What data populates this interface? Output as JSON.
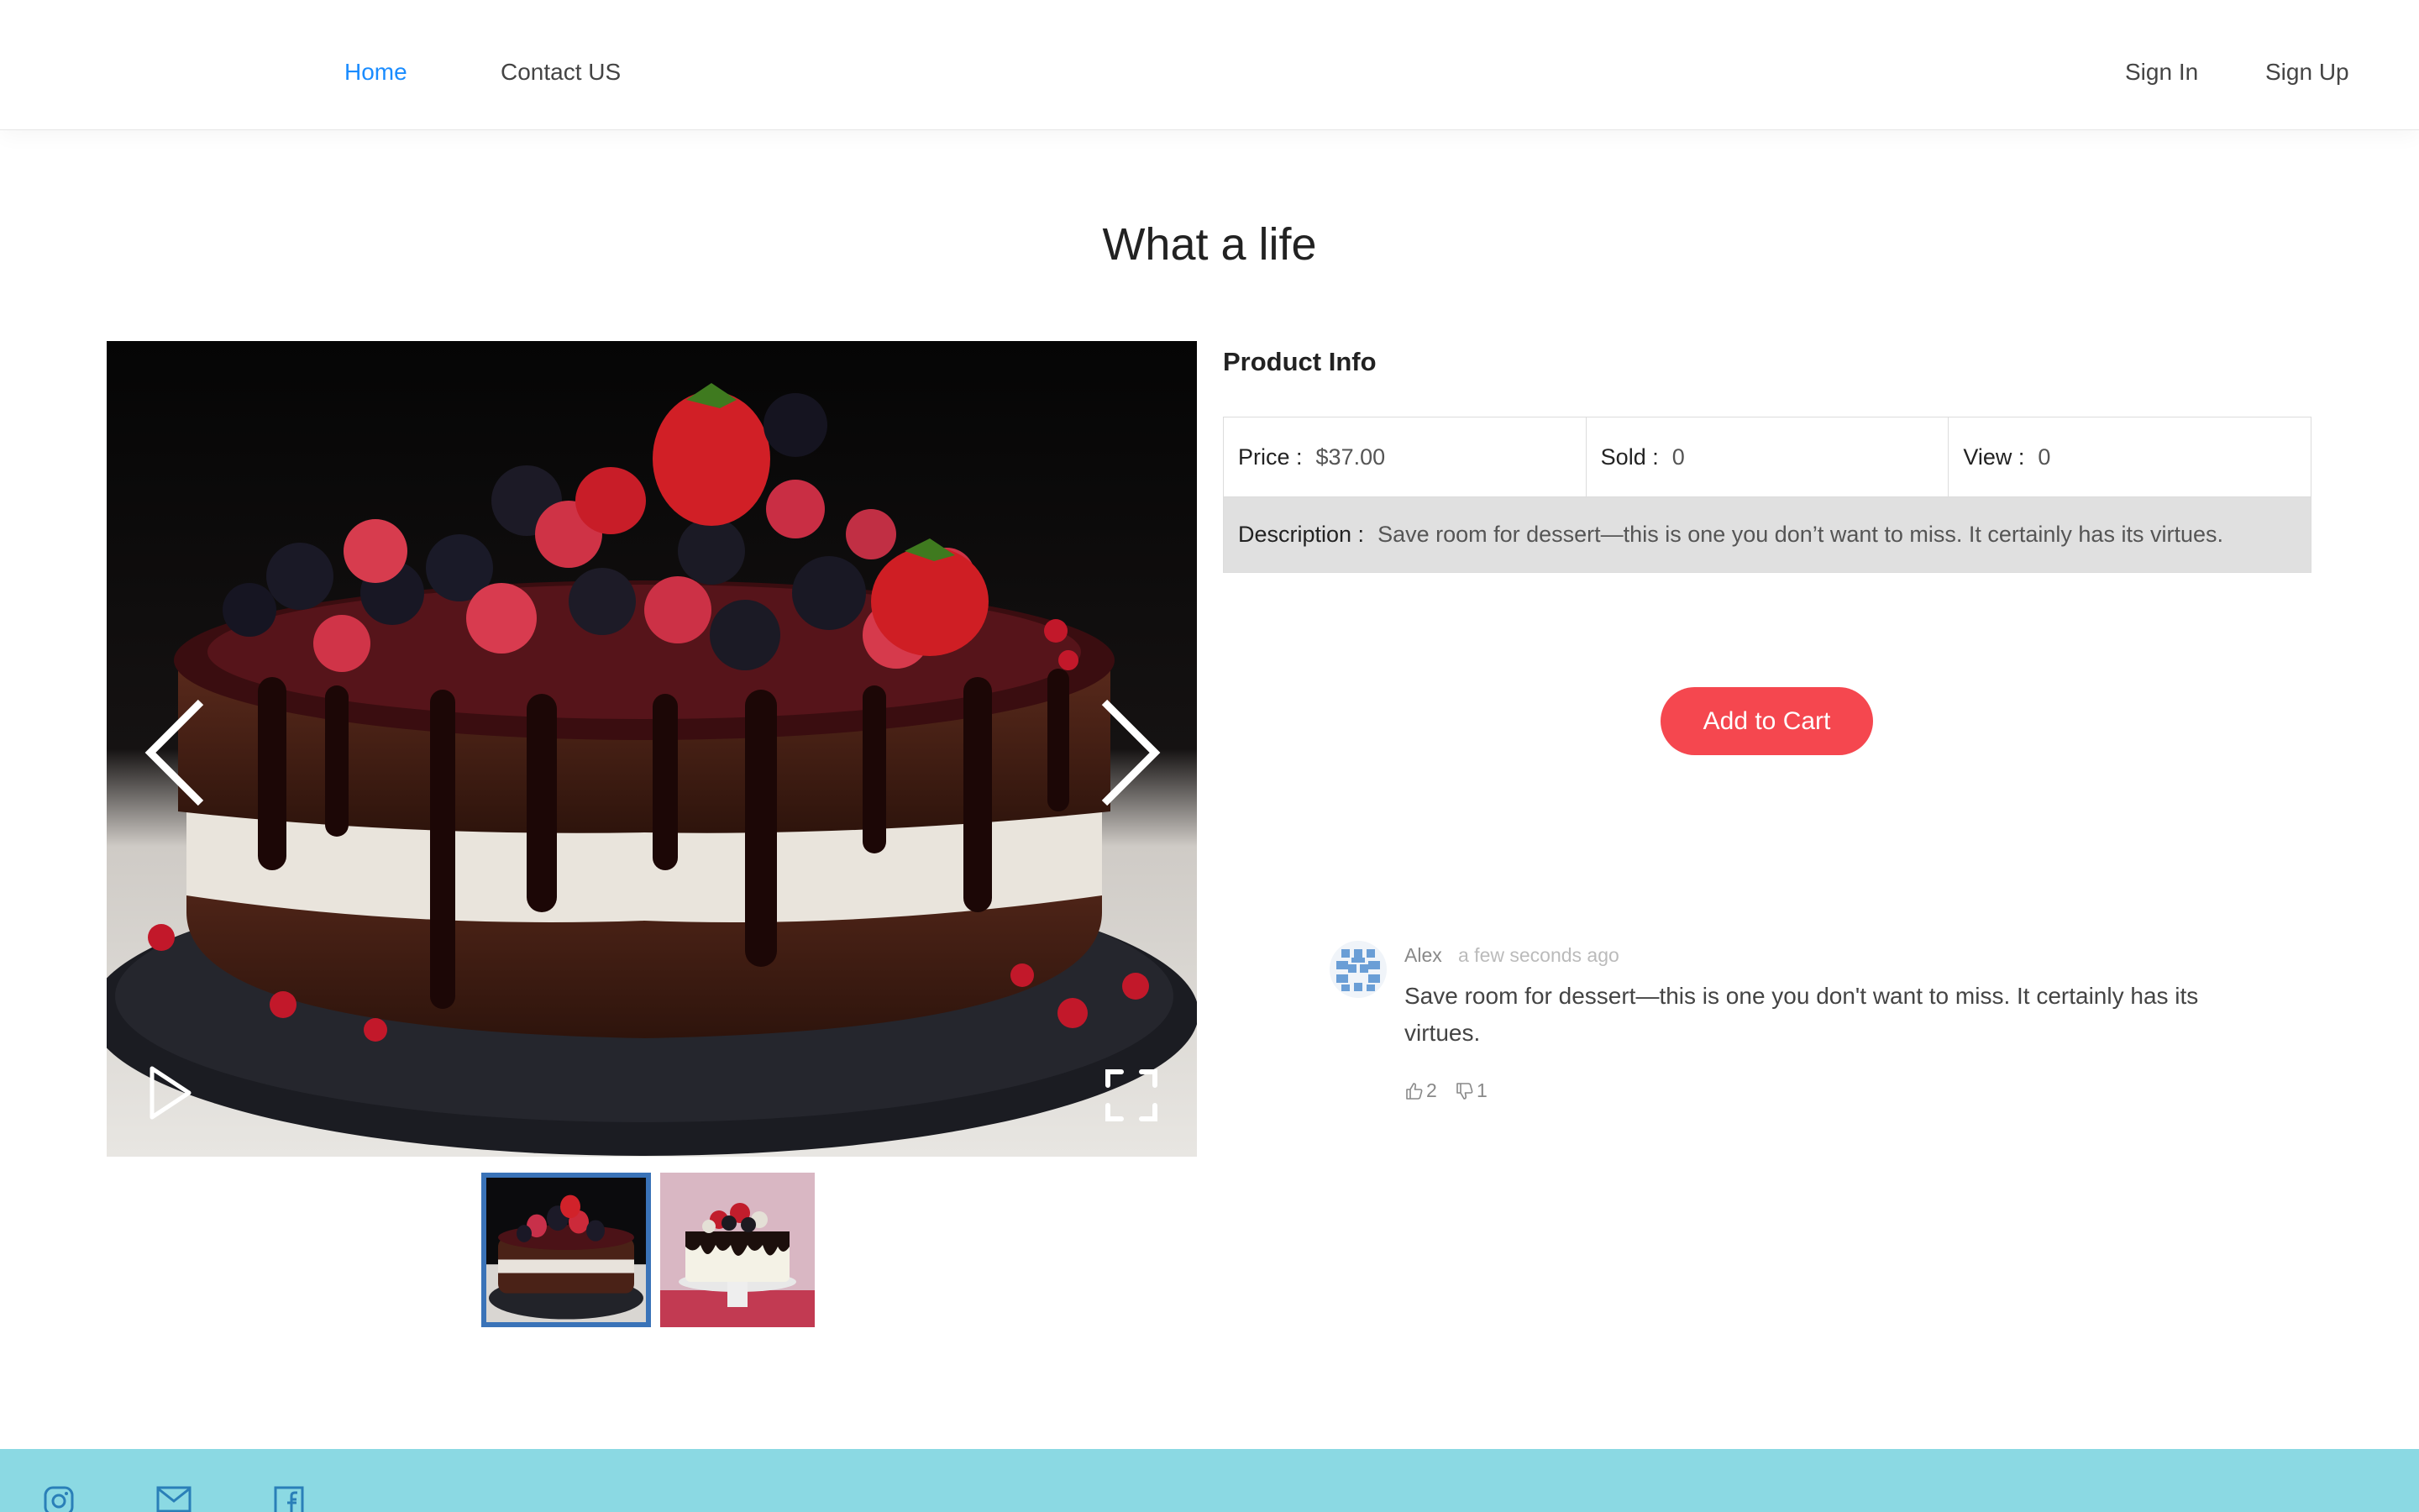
{
  "nav": {
    "home": "Home",
    "contact": "Contact US",
    "sign_in": "Sign In",
    "sign_up": "Sign Up"
  },
  "page": {
    "title": "What a life"
  },
  "gallery": {
    "images": [
      "chocolate-berry-cake",
      "white-drip-cake"
    ],
    "active_index": 0
  },
  "product": {
    "section_title": "Product Info",
    "price_label": "Price :",
    "price": "$37.00",
    "sold_label": "Sold :",
    "sold": "0",
    "view_label": "View :",
    "view": "0",
    "description_label": "Description :",
    "description": "Save room for dessert—this is one you don’t want to miss. It certainly has its virtues."
  },
  "cart": {
    "button_label": "Add to Cart"
  },
  "comment": {
    "author": "Alex",
    "time": "a few seconds ago",
    "text": "Save room for dessert—this is one you don't want to miss. It certainly has its virtues.",
    "likes": "2",
    "dislikes": "1"
  },
  "footer": {
    "icons": [
      "instagram-icon",
      "mail-icon",
      "facebook-icon"
    ]
  },
  "colors": {
    "accent": "#1a8cff",
    "cart_button": "#f5474f",
    "footer_bg": "#8bd9e3",
    "thumb_active_border": "#3a73b8",
    "description_bg": "#e0e0e0"
  }
}
